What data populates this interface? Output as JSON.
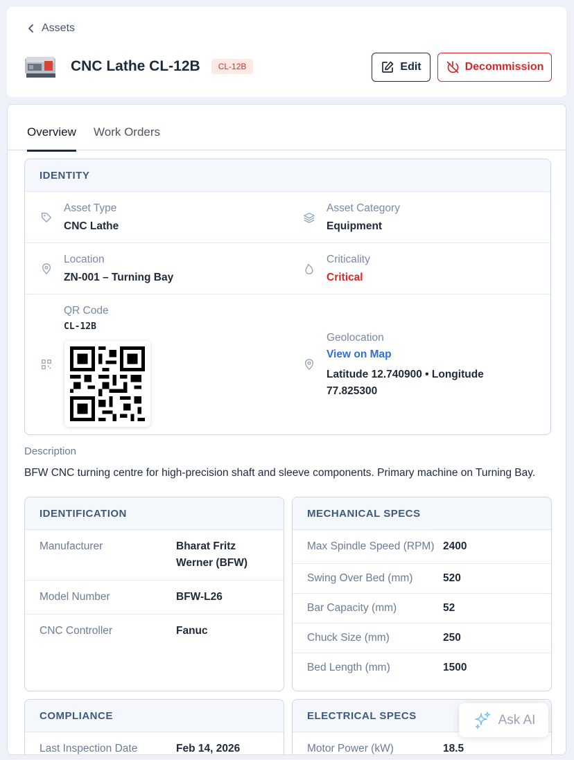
{
  "breadcrumb": {
    "back_label": "Assets"
  },
  "asset": {
    "title": "CNC Lathe CL-12B",
    "code_badge": "CL-12B"
  },
  "actions": {
    "edit_label": "Edit",
    "decommission_label": "Decommission"
  },
  "tabs": [
    {
      "label": "Overview",
      "active": true
    },
    {
      "label": "Work Orders",
      "active": false
    }
  ],
  "identity": {
    "heading": "IDENTITY",
    "asset_type": {
      "label": "Asset Type",
      "value": "CNC Lathe",
      "icon": "tag-icon"
    },
    "asset_category": {
      "label": "Asset Category",
      "value": "Equipment",
      "icon": "layers-icon"
    },
    "location": {
      "label": "Location",
      "value": "ZN-001 – Turning Bay",
      "icon": "map-pin-icon"
    },
    "criticality": {
      "label": "Criticality",
      "value": "Critical",
      "icon": "flame-icon",
      "color": "#dc2626"
    },
    "qr_code": {
      "label": "QR Code",
      "value": "CL-12B",
      "icon": "qr-code-icon"
    },
    "geolocation": {
      "label": "Geolocation",
      "link": "View on Map",
      "value": "Latitude 12.740900 • Longitude 77.825300",
      "icon": "map-pin-icon"
    }
  },
  "description": {
    "label": "Description",
    "text": "BFW CNC turning centre for high-precision shaft and sleeve components. Primary machine on Turning Bay."
  },
  "identification": {
    "heading": "IDENTIFICATION",
    "rows": [
      {
        "key": "Manufacturer",
        "value": "Bharat Fritz Werner (BFW)"
      },
      {
        "key": "Model Number",
        "value": "BFW-L26"
      },
      {
        "key": "CNC Controller",
        "value": "Fanuc"
      }
    ]
  },
  "mechanical": {
    "heading": "MECHANICAL SPECS",
    "rows": [
      {
        "key": "Max Spindle Speed (RPM)",
        "value": "2400"
      },
      {
        "key": "Swing Over Bed (mm)",
        "value": "520"
      },
      {
        "key": "Bar Capacity (mm)",
        "value": "52"
      },
      {
        "key": "Chuck Size (mm)",
        "value": "250"
      },
      {
        "key": "Bed Length (mm)",
        "value": "1500"
      }
    ]
  },
  "compliance": {
    "heading": "COMPLIANCE",
    "rows": [
      {
        "key": "Last Inspection Date",
        "value": "Feb 14, 2026"
      }
    ]
  },
  "electrical": {
    "heading": "ELECTRICAL SPECS",
    "rows": [
      {
        "key": "Motor Power (kW)",
        "value": "18.5"
      }
    ]
  },
  "ask_ai": {
    "label": "Ask AI",
    "icon": "sparkle-icon"
  },
  "colors": {
    "accent": "#1e293b",
    "danger": "#dc2626",
    "link": "#2f6fd8",
    "section_heading": "#3f5a7a"
  }
}
